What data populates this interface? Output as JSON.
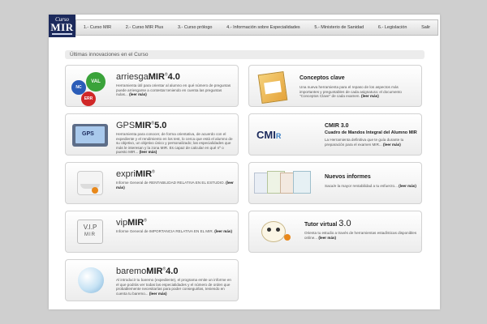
{
  "logo": {
    "line1": "Curso",
    "line2": "MIR"
  },
  "nav": [
    "1.- Curso MIR",
    "2.- Curso MIR Plus",
    "3.- Curso prólogo",
    "4.- Información sobre Especialidades",
    "5.- Ministerio de Sanidad",
    "6.- Legislación",
    "Salir"
  ],
  "section_title": "Últimas innovaciones en el Curso",
  "cards": {
    "arriesga": {
      "prefix": "arriesga",
      "brand": "MIR",
      "version": "4.0",
      "badges": [
        "VAL",
        "NC",
        "ERR"
      ],
      "desc": "Herramienta útil para orientar al alumno en qué número de preguntas puede arriesgarse a contestar teniendo en cuenta las preguntas nulas...",
      "more": "(leer más)"
    },
    "gps": {
      "prefix": "GPS",
      "brand": "MIR",
      "version": "5.0",
      "icon_label": "GPS",
      "desc": "Herramienta para conocer, de forma orientativa, de acuerdo con el expediente y el rendimiento en los test, lo cerca que está el alumno de su objetivo, un objetivo único y personalizado; las especialidades que más le interesan y la zona MIR. Es capaz de calcular en qué nº o puesto MIR...",
      "more": "(leer más)"
    },
    "expri": {
      "prefix": "expri",
      "brand": "MIR",
      "desc": "Informe General de RENTABILIDAD RELATIVA EN EL ESTUDIO.",
      "more": "(leer más)"
    },
    "vip": {
      "prefix": "vip",
      "brand": "MIR",
      "icon_line1": "V.I.P",
      "icon_line2": "MIR",
      "desc": "Informe General de IMPORTANCIA RELATIVA EN EL MIR.",
      "more": "(leer más)"
    },
    "baremo": {
      "prefix": "baremo",
      "brand": "MIR",
      "version": "4.0",
      "desc": "Al introducir tu baremo (expediente), el programa emite un informe en el que podrás ver todas las especialidades y el número de orden que probablemente necesitarías para poder conseguirlas, teniendo en cuenta tu baremo...",
      "more": "(leer más)"
    },
    "conceptos": {
      "title": "Conceptos clave",
      "desc": "Una nueva herramienta para el repaso de los aspectos más importantes y preguntables de cada asignatura: el documento \"Conceptos Clave\" de cada examen.",
      "more": "(leer más)"
    },
    "cmir": {
      "title": "CMIR 3.0",
      "logo": "CMI",
      "logo_r": "R",
      "subtitle": "Cuadro de Mandos Integral del Alumno MIR",
      "desc": "La Herramienta definitiva que te guía durante tu preparación para el examen MIR...",
      "more": "(leer más)"
    },
    "nuevos": {
      "title": "Nuevos informes",
      "desc": "Saca/e la mayor rentabilidad a tu esfuerzo...",
      "more": "(leer más)"
    },
    "tutor": {
      "title": "Tutor virtual",
      "version": "3.0",
      "desc": "Orienta tu estudio a través de herramientas estadísticas disponibles online...",
      "more": "(leer más)"
    }
  },
  "colors": {
    "brand_navy": "#1c2a5c",
    "badge_green": "#3aa33a",
    "badge_blue": "#2a5cb8",
    "badge_red": "#d02828",
    "accent_orange": "#e8881a"
  }
}
